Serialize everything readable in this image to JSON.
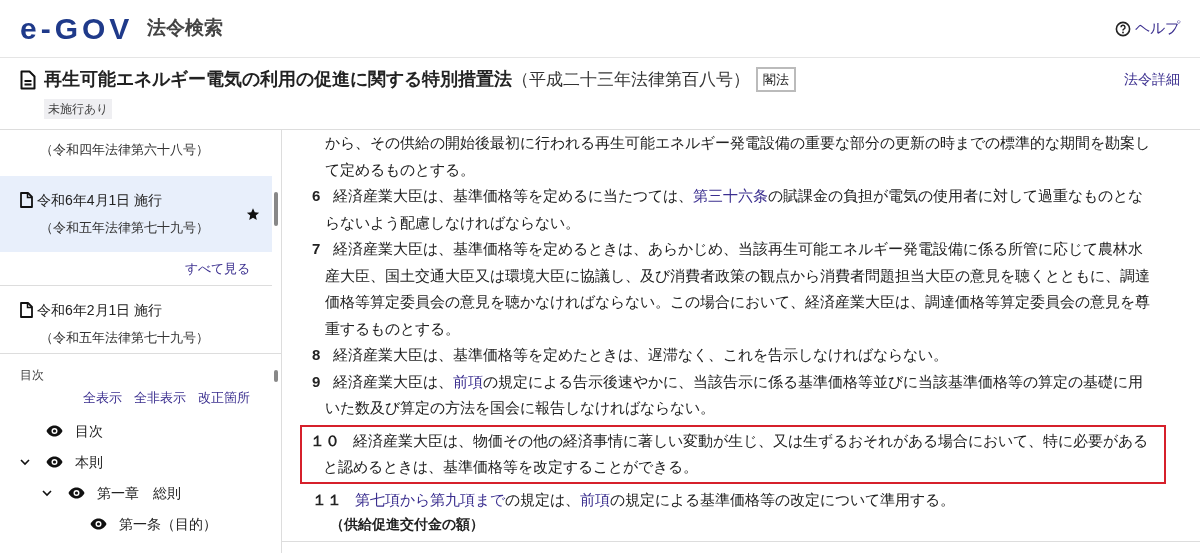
{
  "header": {
    "logo": "e-GOV",
    "service": "法令検索",
    "help": "ヘルプ"
  },
  "law": {
    "title": "再生可能エネルギー電気の利用の促進に関する特別措置法",
    "number": "（平成二十三年法律第百八号）",
    "tag": "閣法",
    "status_badge": "未施行あり",
    "details_link": "法令詳細"
  },
  "amendments": [
    {
      "number": "（令和四年法律第六十八号）",
      "selected": false,
      "starred": false
    },
    {
      "date": "令和6年4月1日 施行",
      "number": "（令和五年法律第七十九号）",
      "selected": true,
      "starred": true,
      "see_all": "すべて見る"
    },
    {
      "date": "令和6年2月1日 施行",
      "number": "（令和五年法律第七十九号）",
      "selected": false,
      "starred": false
    }
  ],
  "toc": {
    "title": "目次",
    "actions": [
      "全表示",
      "全非表示",
      "改正箇所"
    ],
    "items": [
      {
        "label": "目次"
      },
      {
        "label": "本則",
        "expanded": true,
        "children": [
          {
            "label": "第一章　総則",
            "expanded": true,
            "children": [
              {
                "label": "第一条（目的）"
              }
            ]
          }
        ]
      }
    ]
  },
  "paragraphs": [
    {
      "highlighted": false,
      "segments": [
        {
          "text": "から、その供給の開始後最初に行われる再生可能エネルギー発電設備の重要な部分の更新の時までの標準的な期間を勘案して定めるものとする。",
          "kind": "text"
        }
      ]
    },
    {
      "number": "6",
      "highlighted": false,
      "segments": [
        {
          "text": "経済産業大臣は、基準価格等を定めるに当たつては、",
          "kind": "text"
        },
        {
          "text": "第三十六条",
          "kind": "link"
        },
        {
          "text": "の賦課金の負担が電気の使用者に対して過重なものとならないよう配慮しなければならない。",
          "kind": "text"
        }
      ]
    },
    {
      "number": "7",
      "highlighted": false,
      "segments": [
        {
          "text": "経済産業大臣は、基準価格等を定めるときは、あらかじめ、当該再生可能エネルギー発電設備に係る所管に応じて農林水産大臣、国土交通大臣又は環境大臣に協議し、及び消費者政策の観点から消費者問題担当大臣の意見を聴くとともに、調達価格等算定委員会の意見を聴かなければならない。この場合において、経済産業大臣は、調達価格等算定委員会の意見を尊重するものとする。",
          "kind": "text"
        }
      ]
    },
    {
      "number": "8",
      "highlighted": false,
      "segments": [
        {
          "text": "経済産業大臣は、基準価格等を定めたときは、遅滞なく、これを告示しなければならない。",
          "kind": "text"
        }
      ]
    },
    {
      "number": "9",
      "highlighted": false,
      "segments": [
        {
          "text": "経済産業大臣は、",
          "kind": "text"
        },
        {
          "text": "前項",
          "kind": "link"
        },
        {
          "text": "の規定による告示後速やかに、当該告示に係る基準価格等並びに当該基準価格等の算定の基礎に用いた数及び算定の方法を国会に報告しなければならない。",
          "kind": "text"
        }
      ]
    },
    {
      "number": "１０",
      "highlighted": true,
      "segments": [
        {
          "text": "経済産業大臣は、物価その他の経済事情に著しい変動が生じ、又は生ずるおそれがある場合において、特に必要があると認めるときは、基準価格等を改定することができる。",
          "kind": "text"
        }
      ]
    },
    {
      "number": "１１",
      "highlighted": false,
      "segments": [
        {
          "text": "第七項から第九項まで",
          "kind": "link"
        },
        {
          "text": "の規定は、",
          "kind": "text"
        },
        {
          "text": "前項",
          "kind": "link"
        },
        {
          "text": "の規定による基準価格等の改定について準用する。",
          "kind": "text"
        }
      ]
    }
  ],
  "next_heading": "（供給促進交付金の額）"
}
